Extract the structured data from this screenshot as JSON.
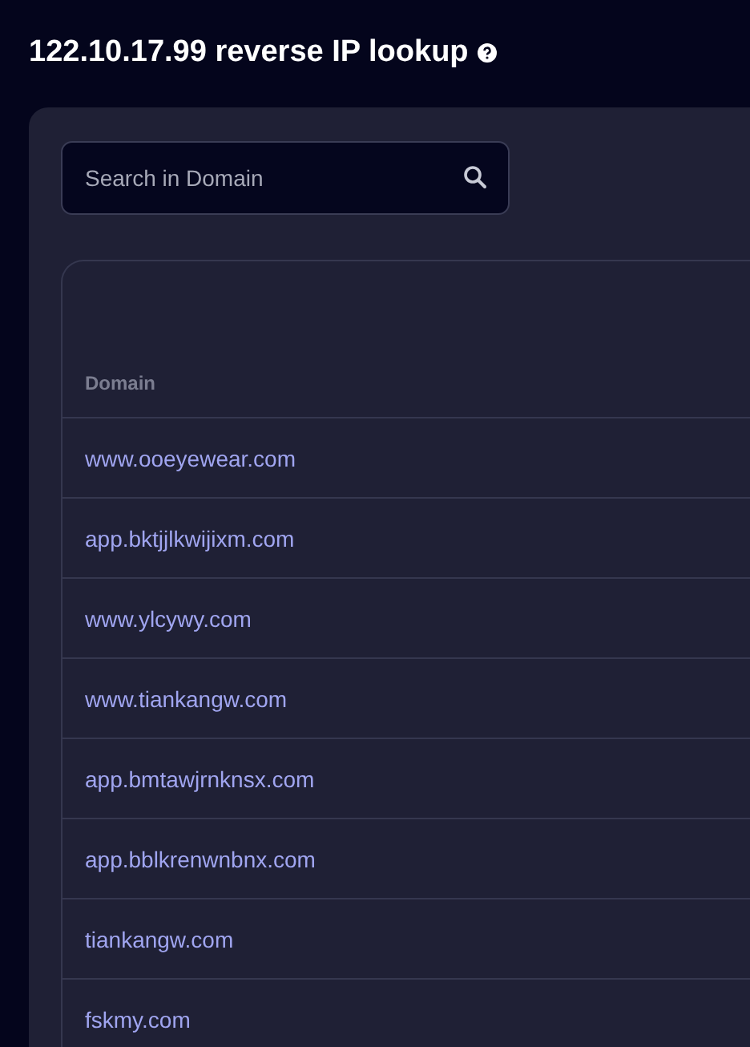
{
  "title": "122.10.17.99 reverse IP lookup",
  "search": {
    "placeholder": "Search in Domain"
  },
  "table": {
    "columns": [
      "Domain"
    ],
    "rows": [
      {
        "domain": "www.ooeyewear.com"
      },
      {
        "domain": "app.bktjjlkwijixm.com"
      },
      {
        "domain": "www.ylcywy.com"
      },
      {
        "domain": "www.tiankangw.com"
      },
      {
        "domain": "app.bmtawjrnknsx.com"
      },
      {
        "domain": "app.bblkrenwnbnx.com"
      },
      {
        "domain": "tiankangw.com"
      },
      {
        "domain": "fskmy.com"
      }
    ]
  }
}
